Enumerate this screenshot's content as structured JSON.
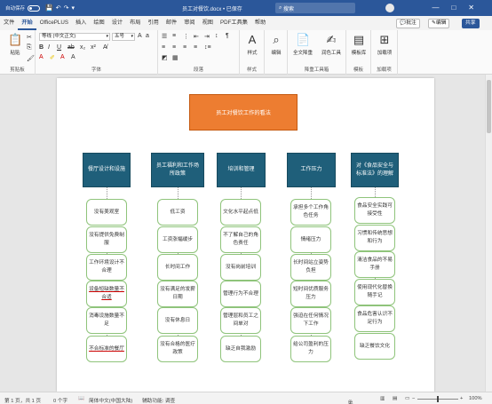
{
  "titlebar": {
    "autosave": "自动保存",
    "doc_name": "员工对餐饮.docx • 已保存",
    "search": "搜索"
  },
  "menu": {
    "tabs": [
      "文件",
      "开始",
      "OfficePLUS",
      "插入",
      "绘图",
      "设计",
      "布局",
      "引用",
      "邮件",
      "审阅",
      "视图",
      "PDF工具集",
      "帮助"
    ],
    "active": "开始",
    "comment": "批注",
    "edit": "编辑",
    "share": "共享"
  },
  "ribbon": {
    "clipboard": {
      "paste": "粘贴",
      "label": "剪贴板"
    },
    "font": {
      "name": "等线 (中文正文)",
      "size": "五号",
      "label": "字体"
    },
    "paragraph": {
      "label": "段落"
    },
    "styles": {
      "styles": "样式",
      "label": "样式"
    },
    "editing": {
      "edit": "编辑"
    },
    "reuse": {
      "full_text": "全文降重",
      "polish": "润色工具",
      "label": "降重工具箱"
    },
    "templates": {
      "btn": "模板库",
      "label": "模板"
    },
    "addins": {
      "btn": "加载项",
      "label": "加载项"
    }
  },
  "mindmap": {
    "title": "员工对餐饮工作的看法",
    "categories": [
      {
        "label": "餐厅设计和设施",
        "items": [
          "没有美观室",
          "没有提供免费制服",
          "工作环境设计不合理",
          "设备短缺数量不合适",
          "消毒设施数量不足",
          "不合标准的餐厅"
        ]
      },
      {
        "label": "员工福利和工作场所政策",
        "items": [
          "低工资",
          "工资涨幅缓步",
          "长时间工作",
          "没有满足的发薪日期",
          "没有休息日",
          "没有合格的医疗政策"
        ]
      },
      {
        "label": "培训和管理",
        "items": [
          "文化水平起点低",
          "不了解自己的角色责任",
          "没有岗前培训",
          "管理行为不合理",
          "管理层和员工之间单对",
          "缺乏自我激励"
        ]
      },
      {
        "label": "工作压力",
        "items": [
          "承担多个工作角色任务",
          "情绪压力",
          "长时间站立姿势负担",
          "短时间优质服务压力",
          "强迫在任何情况下工作",
          "给公司盈利的压力"
        ]
      },
      {
        "label": "对《食品安全与标准法》的理解",
        "items": [
          "食品安全实践可接受性",
          "习惯和传统思想和行为",
          "清洁食品的不易手册",
          "使用现代化替换随手记",
          "食品危害认识不足行为",
          "缺乏餐饮文化"
        ]
      }
    ]
  },
  "statusbar": {
    "page": "第 1 页，共 1 页",
    "words": "0 个字",
    "lang": "简体中文(中国大陆)",
    "access": "辅助功能: 调查",
    "focus": "专注",
    "zoom": "100%"
  },
  "colors": {
    "titlebar": "#2b579a",
    "title_box": "#ed7d31",
    "category_box": "#1f5f7a",
    "leaf_border": "#8fc47b"
  }
}
